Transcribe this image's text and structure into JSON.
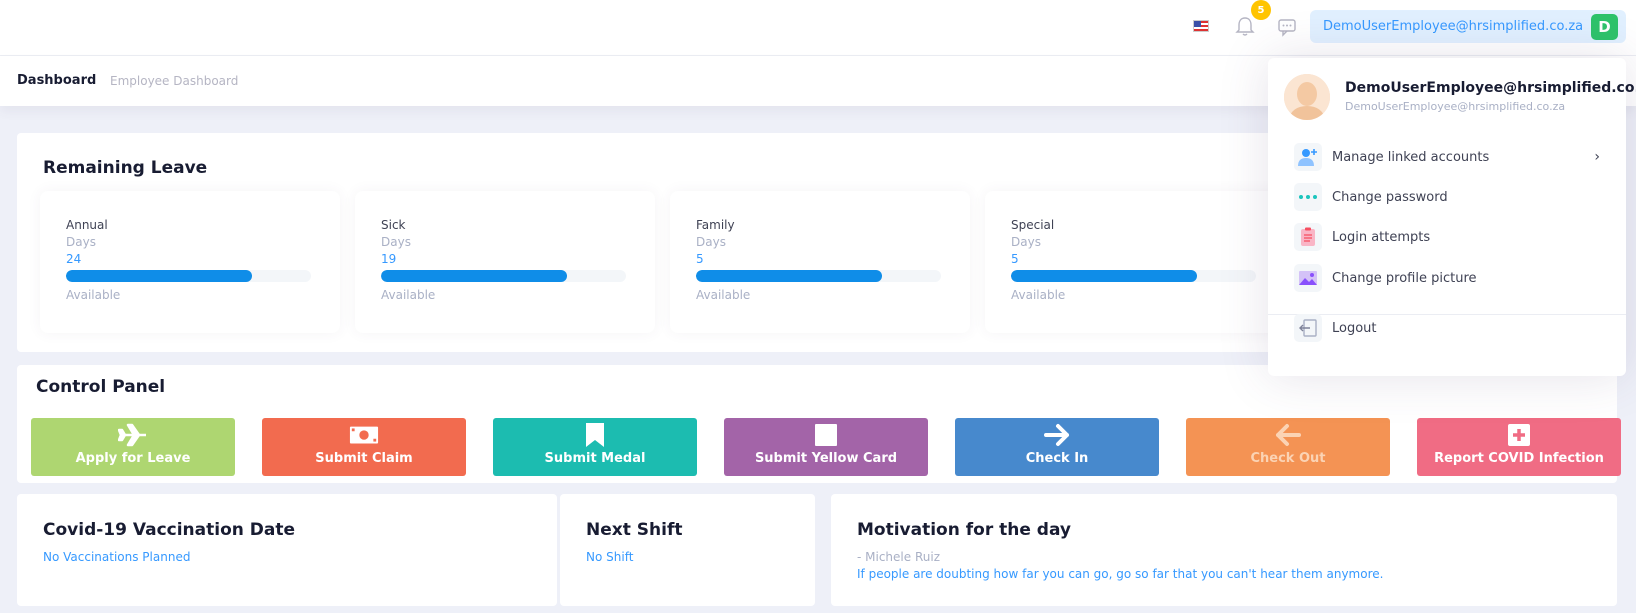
{
  "header": {
    "flag_icon": "us-flag-icon",
    "notification_count": "5",
    "user_email": "DemoUserEmployee@hrsimplified.co.za",
    "user_initial": "D"
  },
  "subheader": {
    "title": "Dashboard",
    "subtitle": "Employee Dashboard"
  },
  "leave": {
    "title": "Remaining Leave",
    "items": [
      {
        "name": "Annual",
        "unit": "Days",
        "value": "24",
        "available_label": "Available",
        "fill_percent": 76
      },
      {
        "name": "Sick",
        "unit": "Days",
        "value": "19",
        "available_label": "Available",
        "fill_percent": 76
      },
      {
        "name": "Family",
        "unit": "Days",
        "value": "5",
        "available_label": "Available",
        "fill_percent": 76
      },
      {
        "name": "Special",
        "unit": "Days",
        "value": "5",
        "available_label": "Available",
        "fill_percent": 76
      }
    ]
  },
  "control_panel": {
    "title": "Control Panel",
    "buttons": [
      {
        "label": "Apply for Leave",
        "icon": "airplane-icon",
        "color": "#aed671"
      },
      {
        "label": "Submit Claim",
        "icon": "money-icon",
        "color": "#f26b4f"
      },
      {
        "label": "Submit Medal",
        "icon": "bookmark-icon",
        "color": "#1cbcb0"
      },
      {
        "label": "Submit Yellow Card",
        "icon": "card-icon",
        "color": "#a364a8"
      },
      {
        "label": "Check In",
        "icon": "arrow-right-icon",
        "color": "#4789cd"
      },
      {
        "label": "Check Out",
        "icon": "arrow-left-icon",
        "color": "#f49354"
      },
      {
        "label": "Report COVID Infection",
        "icon": "plus-icon",
        "color": "#f06c84"
      }
    ]
  },
  "vaccination": {
    "title": "Covid-19 Vaccination Date",
    "value": "No Vaccinations Planned"
  },
  "shift": {
    "title": "Next Shift",
    "value": "No Shift"
  },
  "motivation": {
    "title": "Motivation for the day",
    "author": "- Michele Ruiz",
    "quote": "If people are doubting how far you can go, go so far that you can't hear them anymore."
  },
  "user_menu": {
    "name": "DemoUserEmployee@hrsimplified.co.za",
    "email": "DemoUserEmployee@hrsimplified.co.za",
    "items": [
      {
        "label": "Manage linked accounts",
        "icon": "add-user-icon"
      },
      {
        "label": "Change password",
        "icon": "dots-icon"
      },
      {
        "label": "Login attempts",
        "icon": "clipboard-icon"
      },
      {
        "label": "Change profile picture",
        "icon": "image-icon"
      }
    ],
    "logout_label": "Logout"
  }
}
